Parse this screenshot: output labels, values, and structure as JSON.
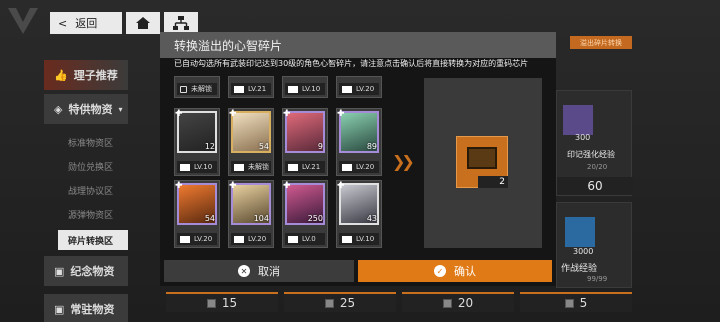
{
  "top_bar": {
    "back_label": "返回"
  },
  "sidebar": {
    "main_items": [
      "理子推荐",
      "特供物资",
      "纪念物资",
      "常驻物资"
    ],
    "sub_items": [
      "标准物资区",
      "勋位兑换区",
      "战理协议区",
      "源弹物资区",
      "碎片转换区"
    ]
  },
  "background": {
    "tag_label": "溢出碎片转换",
    "card_labels": [
      "印记强化经验",
      "作战经验"
    ],
    "card_counts": [
      "300",
      "3000"
    ],
    "card_limits": [
      "20/20",
      "99/99"
    ],
    "card_cost_60": "60",
    "bottom_counts": [
      "15",
      "25",
      "20",
      "5"
    ]
  },
  "modal": {
    "title": "转换溢出的心智碎片",
    "subtitle": "已自动勾选所有武装印记达到30级的角色心智碎片，请注意点击确认后将直接转换为对应的重码芯片",
    "half_row": [
      {
        "level": "未解锁",
        "locked": true
      },
      {
        "level": "LV.21"
      },
      {
        "level": "LV.10"
      },
      {
        "level": "LV.20"
      }
    ],
    "row2": [
      {
        "count": "12",
        "level": "LV.10",
        "frame": "white"
      },
      {
        "count": "54",
        "level": "未解锁",
        "frame": "gold"
      },
      {
        "count": "9",
        "level": "LV.21",
        "frame": "purple"
      },
      {
        "count": "89",
        "level": "LV.20",
        "frame": "purple"
      }
    ],
    "row3": [
      {
        "count": "54",
        "level": "LV.20",
        "frame": "purple"
      },
      {
        "count": "104",
        "level": "LV.20",
        "frame": "purple"
      },
      {
        "count": "250",
        "level": "LV.0",
        "frame": "purple"
      },
      {
        "count": "43",
        "level": "LV.10",
        "frame": "white"
      }
    ],
    "result_count": "2",
    "cancel_label": "取消",
    "confirm_label": "确认"
  }
}
